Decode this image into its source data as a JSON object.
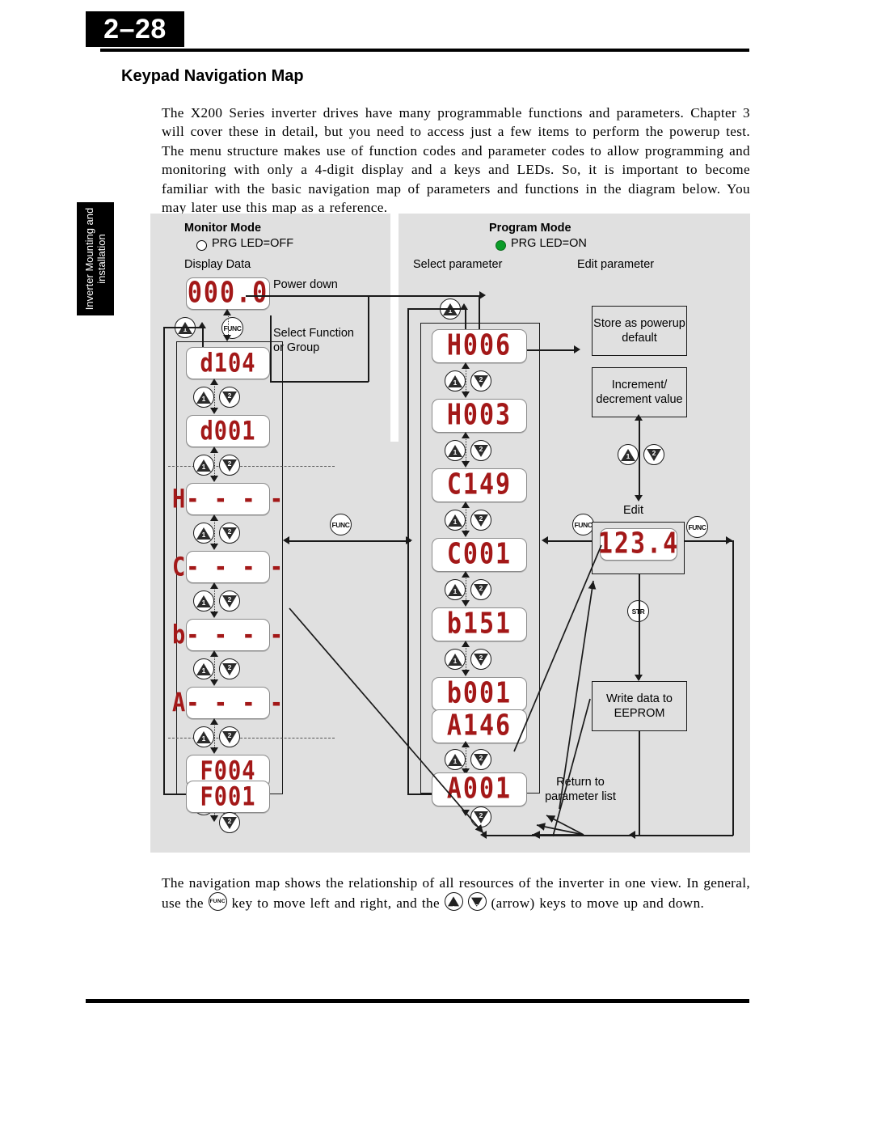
{
  "page": {
    "number": "2–28",
    "heading": "Keypad Navigation Map",
    "sidebar_tab": "Inverter Mounting and installation",
    "intro_paragraph": "The X200 Series inverter drives have many programmable functions and parameters. Chapter 3 will cover these in detail, but you need to access just a few items to perform the powerup test. The menu structure makes use of function codes and parameter codes to allow programming and monitoring with only a 4-digit display and a keys and LEDs. So, it is important to become familiar with the basic navigation map of parameters and functions in the diagram below. You may later use this map as a reference.",
    "closing_part1": "The navigation map shows the relationship of all resources of the inverter in one view. In general, use the",
    "closing_part2": "key to move left and right, and the",
    "closing_part3": "(arrow) keys to move up and down."
  },
  "diagram": {
    "monitor_mode": {
      "title": "Monitor Mode",
      "led_state": "PRG LED=OFF",
      "led_color": "#ffffff",
      "column_label": "Display Data",
      "powerdown_label": "Power down",
      "select_box_label": "Select Function or Group",
      "top_display": "000.0",
      "items": [
        "d104",
        "d001",
        "H- - - -",
        "C- - - -",
        "b- - - -",
        "A- - - -",
        "F004",
        "F001"
      ]
    },
    "program_mode": {
      "title": "Program Mode",
      "led_state": "PRG LED=ON",
      "led_color": "#0a9c28",
      "column_label_select": "Select parameter",
      "column_label_edit": "Edit parameter",
      "items": [
        "H006",
        "H003",
        "C149",
        "C001",
        "b151",
        "b001",
        "A146",
        "A001"
      ],
      "store_box": "Store as powerup default",
      "increment_box": "Increment/ decrement value",
      "edit_label": "Edit",
      "edit_display": "123.4",
      "eeprom_box": "Write data to EEPROM",
      "return_label": "Return to parameter list"
    },
    "keys": {
      "func": "FUNC",
      "str": "STR",
      "up_num": "1",
      "down_num": "2"
    },
    "colors": {
      "panel_grey": "#e0e0e0",
      "segment_red": "#a31818",
      "led_on_green": "#0a9c28",
      "line_black": "#1a1a1a"
    }
  }
}
